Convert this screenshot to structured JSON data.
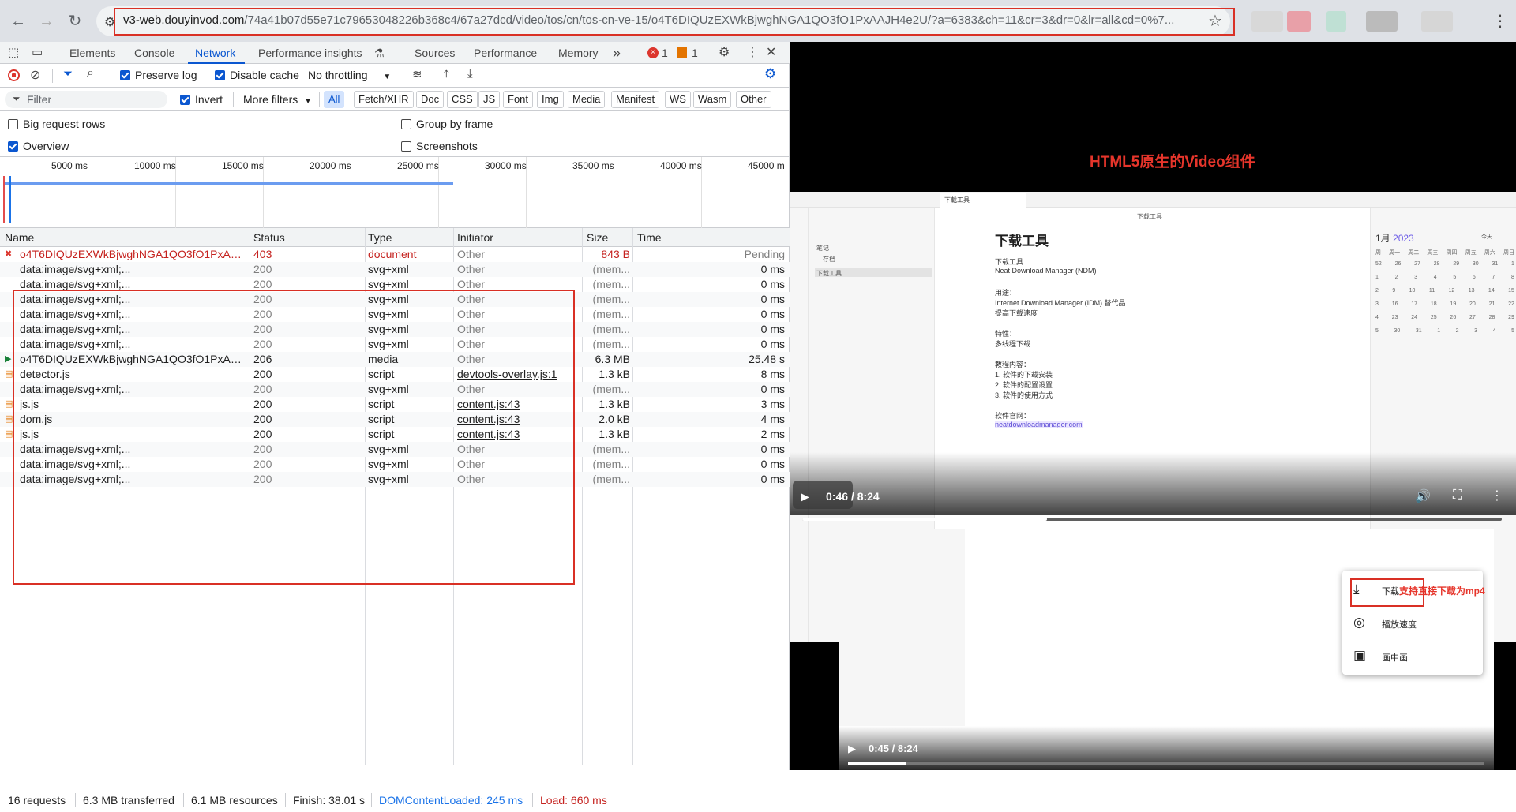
{
  "browser": {
    "url_host": "v3-web.douyinvod.com",
    "url_path": "/74a41b07d55e71c79653048226b368c4/67a27dcd/video/tos/cn/tos-cn-ve-15/o4T6DIQUzEXWkBjwghNGA1QO3fO1PxAAJH4e2U/?a=6383&ch=11&cr=3&dr=0&lr=all&cd=0%7..."
  },
  "devtools": {
    "tabs": [
      "Elements",
      "Console",
      "Network",
      "Performance insights",
      "Sources",
      "Performance",
      "Memory"
    ],
    "more_tabs": "»",
    "error_count": "1",
    "warning_count": "1",
    "toolbar": {
      "preserve_log": "Preserve log",
      "disable_cache": "Disable cache",
      "throttling": "No throttling"
    },
    "filter": {
      "placeholder": "Filter",
      "invert": "Invert",
      "more_filters": "More filters",
      "chips": [
        "All",
        "Fetch/XHR",
        "Doc",
        "CSS",
        "JS",
        "Font",
        "Img",
        "Media",
        "Manifest",
        "WS",
        "Wasm",
        "Other"
      ]
    },
    "options": {
      "big_request_rows": "Big request rows",
      "group_by_frame": "Group by frame",
      "overview": "Overview",
      "screenshots": "Screenshots"
    },
    "overview_ticks": [
      "5000 ms",
      "10000 ms",
      "15000 ms",
      "20000 ms",
      "25000 ms",
      "30000 ms",
      "35000 ms",
      "40000 ms",
      "45000 m"
    ],
    "columns": [
      "Name",
      "Status",
      "Type",
      "Initiator",
      "Size",
      "Time"
    ],
    "rows": [
      {
        "name": "o4T6DIQUzEXWkBjwghNGA1QO3fO1PxAAJH4e2U",
        "status": "403",
        "type": "document",
        "initiator": "Other",
        "size": "843 B",
        "time": "Pending"
      },
      {
        "name": "data:image/svg+xml;...",
        "status": "200",
        "type": "svg+xml",
        "initiator": "Other",
        "size": "(mem...",
        "time": "0 ms"
      },
      {
        "name": "data:image/svg+xml;...",
        "status": "200",
        "type": "svg+xml",
        "initiator": "Other",
        "size": "(mem...",
        "time": "0 ms"
      },
      {
        "name": "data:image/svg+xml;...",
        "status": "200",
        "type": "svg+xml",
        "initiator": "Other",
        "size": "(mem...",
        "time": "0 ms"
      },
      {
        "name": "data:image/svg+xml;...",
        "status": "200",
        "type": "svg+xml",
        "initiator": "Other",
        "size": "(mem...",
        "time": "0 ms"
      },
      {
        "name": "data:image/svg+xml;...",
        "status": "200",
        "type": "svg+xml",
        "initiator": "Other",
        "size": "(mem...",
        "time": "0 ms"
      },
      {
        "name": "data:image/svg+xml;...",
        "status": "200",
        "type": "svg+xml",
        "initiator": "Other",
        "size": "(mem...",
        "time": "0 ms"
      },
      {
        "name": "o4T6DIQUzEXWkBjwghNGA1QO3fO1PxAAJH4e2U",
        "status": "206",
        "type": "media",
        "initiator": "Other",
        "size": "6.3 MB",
        "time": "25.48 s"
      },
      {
        "name": "detector.js",
        "status": "200",
        "type": "script",
        "initiator": "devtools-overlay.js:1",
        "size": "1.3 kB",
        "time": "8 ms"
      },
      {
        "name": "data:image/svg+xml;...",
        "status": "200",
        "type": "svg+xml",
        "initiator": "Other",
        "size": "(mem...",
        "time": "0 ms"
      },
      {
        "name": "js.js",
        "status": "200",
        "type": "script",
        "initiator": "content.js:43",
        "size": "1.3 kB",
        "time": "3 ms"
      },
      {
        "name": "dom.js",
        "status": "200",
        "type": "script",
        "initiator": "content.js:43",
        "size": "2.0 kB",
        "time": "4 ms"
      },
      {
        "name": "js.js",
        "status": "200",
        "type": "script",
        "initiator": "content.js:43",
        "size": "1.3 kB",
        "time": "2 ms"
      },
      {
        "name": "data:image/svg+xml;...",
        "status": "200",
        "type": "svg+xml",
        "initiator": "Other",
        "size": "(mem...",
        "time": "0 ms"
      },
      {
        "name": "data:image/svg+xml;...",
        "status": "200",
        "type": "svg+xml",
        "initiator": "Other",
        "size": "(mem...",
        "time": "0 ms"
      },
      {
        "name": "data:image/svg+xml;...",
        "status": "200",
        "type": "svg+xml",
        "initiator": "Other",
        "size": "(mem...",
        "time": "0 ms"
      }
    ],
    "status_bar": {
      "requests": "16 requests",
      "transferred": "6.3 MB transferred",
      "resources": "6.1 MB resources",
      "finish": "Finish: 38.01 s",
      "dcl": "DOMContentLoaded: 245 ms",
      "load": "Load: 660 ms"
    }
  },
  "viewer": {
    "heading": "HTML5原生的Video组件",
    "app_tab": "下载工具",
    "doc_crumb": "下载工具",
    "tree": [
      "笔记",
      "存档",
      "下载工具"
    ],
    "doc_title": "下载工具",
    "doc_lines": [
      "下载工具",
      "Neat Download Manager (NDM)",
      "",
      "用途：",
      "Internet Download Manager (IDM) 替代品",
      "提高下载速度",
      "",
      "特性：",
      "多线程下载",
      "",
      "教程内容：",
      "1. 软件的下载安装",
      "2. 软件的配置设置",
      "3. 软件的使用方式",
      "",
      "软件官网："
    ],
    "doc_link": "neatdownloadmanager.com",
    "calendar": {
      "month": "1月",
      "year": "2023",
      "today": "今天",
      "weekdays": [
        "周",
        "周一",
        "周二",
        "周三",
        "周四",
        "周五",
        "周六",
        "周日"
      ],
      "weeks": [
        [
          "52",
          "26",
          "27",
          "28",
          "29",
          "30",
          "31",
          "1"
        ],
        [
          "1",
          "2",
          "3",
          "4",
          "5",
          "6",
          "7",
          "8"
        ],
        [
          "2",
          "9",
          "10",
          "11",
          "12",
          "13",
          "14",
          "15"
        ],
        [
          "3",
          "16",
          "17",
          "18",
          "19",
          "20",
          "21",
          "22"
        ],
        [
          "4",
          "23",
          "24",
          "25",
          "26",
          "27",
          "28",
          "29"
        ],
        [
          "5",
          "30",
          "31",
          "1",
          "2",
          "3",
          "4",
          "5"
        ]
      ]
    },
    "video_time": "0:46 / 8:24",
    "video_progress": 0.35,
    "video2_time": "0:45 / 8:24",
    "video2_progress": 0.09,
    "menu": {
      "download": "下载",
      "download_note": "支持直接下载为mp4",
      "speed": "播放速度",
      "pip": "画中画"
    }
  }
}
